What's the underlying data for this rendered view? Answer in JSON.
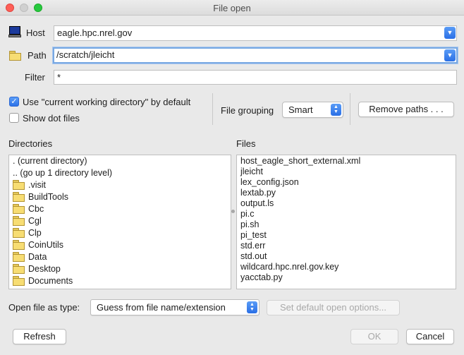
{
  "window": {
    "title": "File open"
  },
  "host": {
    "label": "Host",
    "value": "eagle.hpc.nrel.gov"
  },
  "path": {
    "label": "Path",
    "value": "/scratch/jleicht"
  },
  "filter": {
    "label": "Filter",
    "value": "*"
  },
  "options": {
    "use_cwd_label": "Use \"current working directory\" by default",
    "use_cwd_checked": true,
    "show_dot_label": "Show dot files",
    "show_dot_checked": false,
    "file_grouping_label": "File grouping",
    "file_grouping_value": "Smart",
    "remove_paths_label": "Remove paths . . ."
  },
  "directories": {
    "label": "Directories",
    "items": [
      {
        "text": ". (current directory)",
        "icon": ""
      },
      {
        "text": ".. (go up 1 directory level)",
        "icon": ""
      },
      {
        "text": ".visit",
        "icon": "folder-icon"
      },
      {
        "text": "BuildTools",
        "icon": "folder-icon"
      },
      {
        "text": "Cbc",
        "icon": "folder-icon"
      },
      {
        "text": "Cgl",
        "icon": "folder-icon"
      },
      {
        "text": "Clp",
        "icon": "folder-icon"
      },
      {
        "text": "CoinUtils",
        "icon": "folder-icon"
      },
      {
        "text": "Data",
        "icon": "folder-icon"
      },
      {
        "text": "Desktop",
        "icon": "folder-icon"
      },
      {
        "text": "Documents",
        "icon": "folder-icon"
      }
    ]
  },
  "files": {
    "label": "Files",
    "items": [
      "host_eagle_short_external.xml",
      "jleicht",
      "lex_config.json",
      "lextab.py",
      "output.ls",
      "pi.c",
      "pi.sh",
      "pi_test",
      "std.err",
      "std.out",
      "wildcard.hpc.nrel.gov.key",
      "yacctab.py"
    ]
  },
  "open_as": {
    "label": "Open file as type:",
    "value": "Guess from file name/extension"
  },
  "set_default_label": "Set default open options...",
  "buttons": {
    "refresh": "Refresh",
    "ok": "OK",
    "cancel": "Cancel"
  },
  "colors": {
    "accent": "#2a6fe6",
    "focus_ring": "#78a8e2",
    "folder": "#f7dd73"
  }
}
